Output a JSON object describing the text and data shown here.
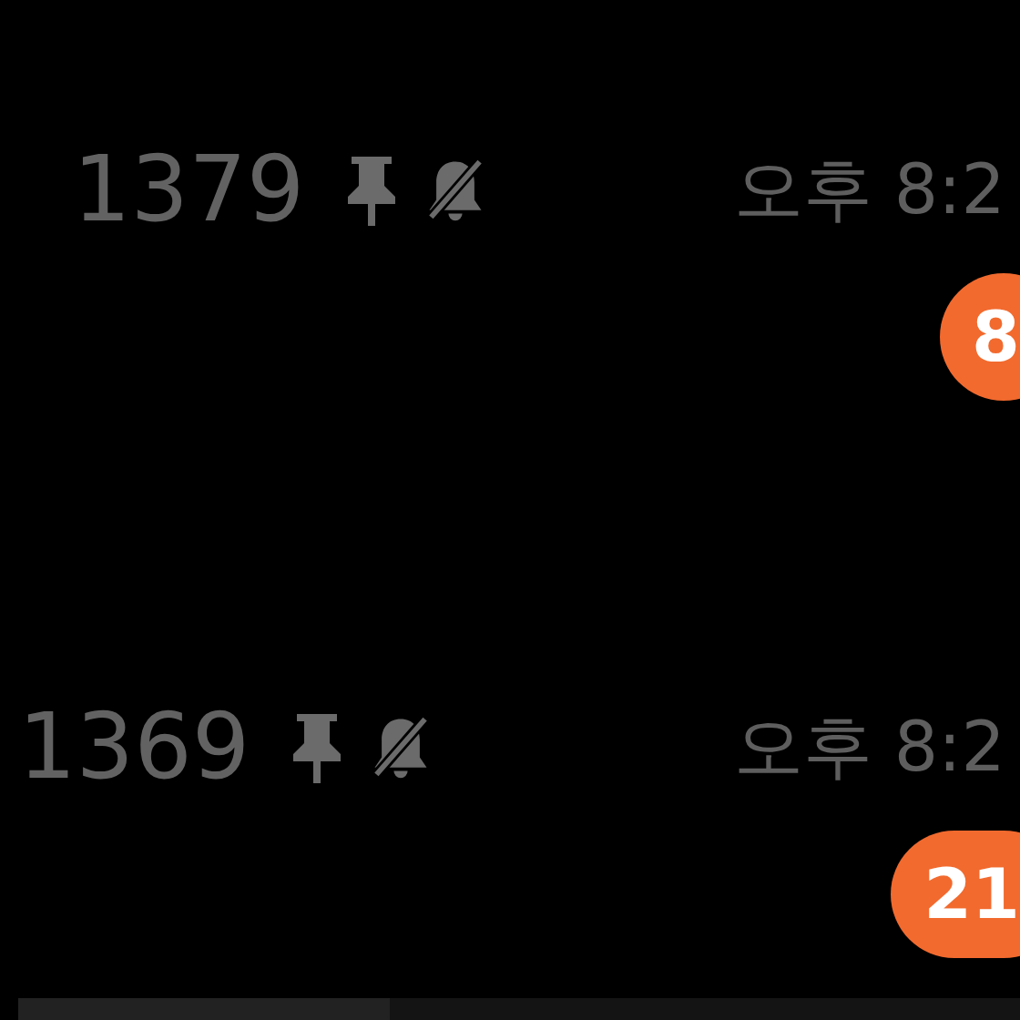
{
  "chats": [
    {
      "name": "1379",
      "pinned": true,
      "muted": true,
      "time": "오후 8:2",
      "unread": "8"
    },
    {
      "name": "1369",
      "pinned": true,
      "muted": true,
      "time": "오후 8:2",
      "unread": "21"
    }
  ],
  "progress": {
    "level": 0.37
  }
}
